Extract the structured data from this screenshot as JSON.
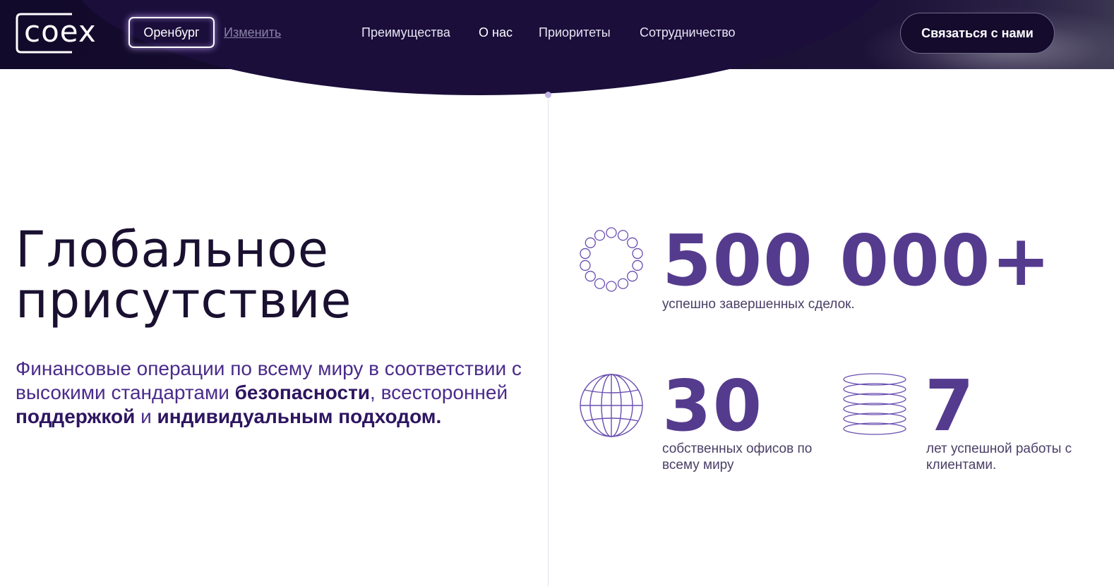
{
  "header": {
    "logo_text": "coex",
    "city": "Оренбург",
    "change_link": "Изменить",
    "nav": [
      "Преимущества",
      "О нас",
      "Приоритеты",
      "Сотрудничество"
    ],
    "contact_button": "Связаться с нами"
  },
  "hero": {
    "title_line1": "Глобальное",
    "title_line2": "присутствие",
    "lead": {
      "part1": "Финансовые операции по всему миру в соответствии с высокими стандартами ",
      "bold1": "безопасности",
      "part2": ", всесторонней ",
      "bold2": "поддержкой",
      "part3": " и ",
      "bold3": "индивидуальным подходом."
    }
  },
  "stats": [
    {
      "value": "500 000+",
      "caption": "успешно завершенных сделок.",
      "icon": "ring-of-circles-icon"
    },
    {
      "value": "30",
      "caption": "собственных офисов по всему миру",
      "icon": "globe-icon"
    },
    {
      "value": "7",
      "caption": "лет успешной работы с клиентами.",
      "icon": "stacked-rings-icon"
    }
  ],
  "colors": {
    "header_bg": "#120a2a",
    "accent": "#553b8e",
    "title": "#1a1030",
    "lead": "#4a2b8a"
  }
}
